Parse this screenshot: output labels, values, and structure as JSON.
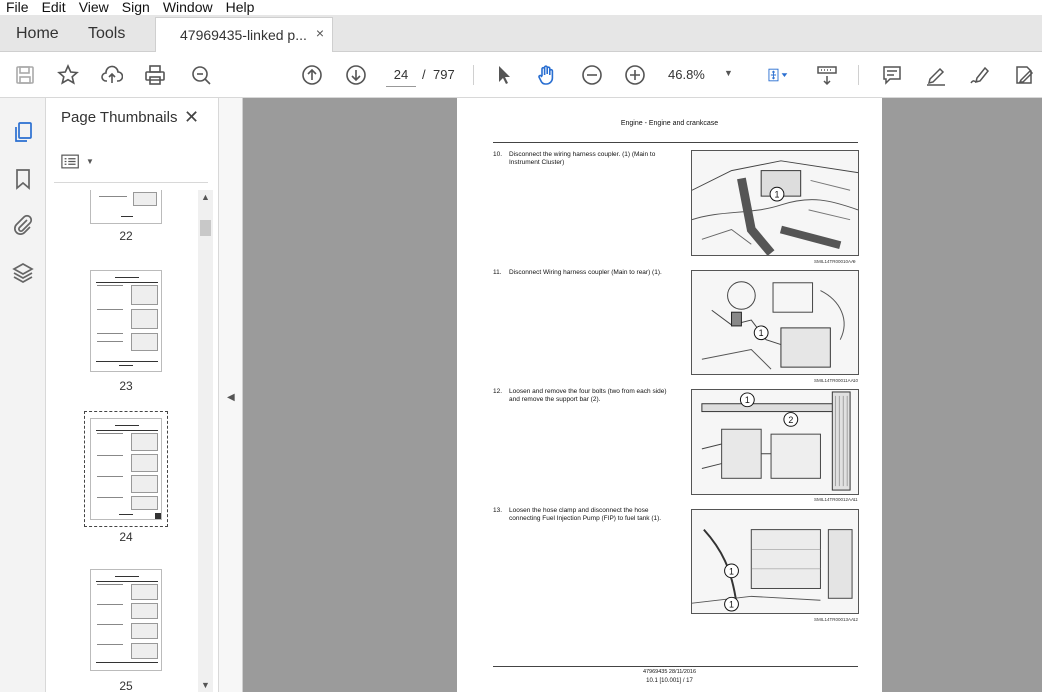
{
  "menu": [
    "File",
    "Edit",
    "View",
    "Sign",
    "Window",
    "Help"
  ],
  "tabs": {
    "home": "Home",
    "tools": "Tools",
    "document": "47969435-linked p...",
    "close": "×"
  },
  "toolbar": {
    "page_current": "24",
    "page_separator": "/",
    "page_total": "797",
    "zoom": "46.8%"
  },
  "panel": {
    "title": "Page Thumbnails",
    "close": "✕",
    "thumbnails": [
      "22",
      "23",
      "24",
      "25"
    ],
    "selected": "24"
  },
  "page": {
    "header": "Engine - Engine and crankcase",
    "steps": [
      {
        "num": "10.",
        "text": "Disconnect the wiring harness coupler.  (1) (Main to Instrument Cluster)",
        "caption": "SMIL14TR00010AA",
        "fig": "9"
      },
      {
        "num": "11.",
        "text": "Disconnect Wiring harness coupler (Main to rear) (1).",
        "caption": "SMIL14TR00011AA",
        "fig": "10"
      },
      {
        "num": "12.",
        "text": "Loosen and remove the four bolts (two from each side) and remove the support bar (2).",
        "caption": "SMIL14TR00012AA",
        "fig": "11"
      },
      {
        "num": "13.",
        "text": "Loosen the hose clamp and disconnect the hose connecting Fuel Injection Pump (FIP) to fuel tank (1).",
        "caption": "SMIL14TR00013AA",
        "fig": "12"
      }
    ],
    "footer_line1": "47969435 28/11/2016",
    "footer_line2": "10.1 [10.001] / 17"
  },
  "callouts": [
    "1",
    "1",
    "1",
    "2",
    "1",
    "1"
  ]
}
